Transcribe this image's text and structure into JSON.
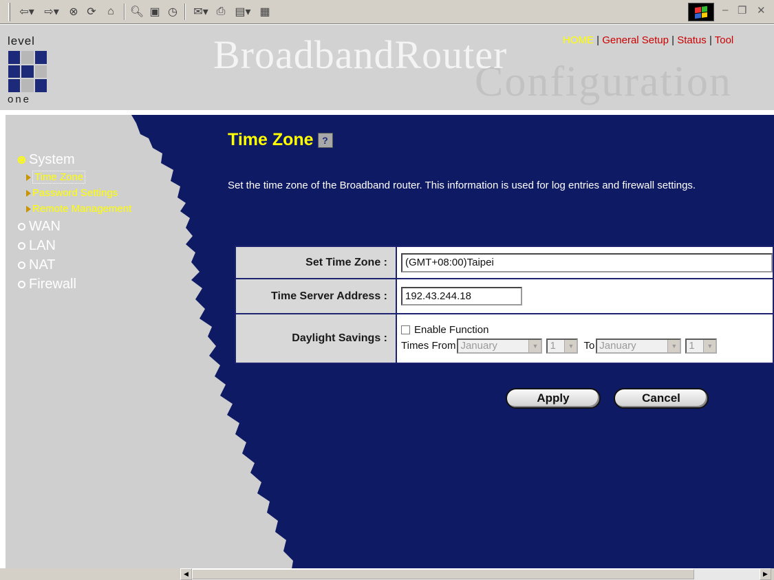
{
  "toolbar": {
    "icons": [
      "back-icon",
      "forward-icon",
      "stop-icon",
      "refresh-icon",
      "home-icon",
      "search-icon",
      "favorites-icon",
      "history-icon",
      "mail-icon",
      "print-icon",
      "edit-icon",
      "discuss-icon"
    ]
  },
  "header": {
    "logo_top": "level",
    "logo_bottom": "one",
    "brand": "BroadbandRouter",
    "subbrand": "Configuration",
    "nav": {
      "home": "HOME",
      "general": "General Setup",
      "status": "Status",
      "tool": "Tool",
      "sep": "|"
    }
  },
  "sidebar": {
    "system": "System",
    "sub": [
      "Time Zone",
      "Password Settings",
      "Remote Management"
    ],
    "wan": "WAN",
    "lan": "LAN",
    "nat": "NAT",
    "firewall": "Firewall"
  },
  "main": {
    "title": "Time Zone",
    "description": "Set the time zone of the Broadband router. This information is used for log entries and firewall settings.",
    "set_time_zone_label": "Set Time Zone :",
    "set_time_zone_value": "(GMT+08:00)Taipei",
    "time_server_label": "Time Server Address :",
    "time_server_value": "192.43.244.18",
    "daylight_label": "Daylight Savings :",
    "enable_function": "Enable Function",
    "times_from": "Times From",
    "to": "To",
    "from_month": "January",
    "from_day": "1",
    "to_month": "January",
    "to_day": "1",
    "apply": "Apply",
    "cancel": "Cancel"
  },
  "colors": {
    "navy": "#0f1a64",
    "gray": "#cfcfcf",
    "yellow": "#ffff00",
    "red": "#cc0000"
  }
}
